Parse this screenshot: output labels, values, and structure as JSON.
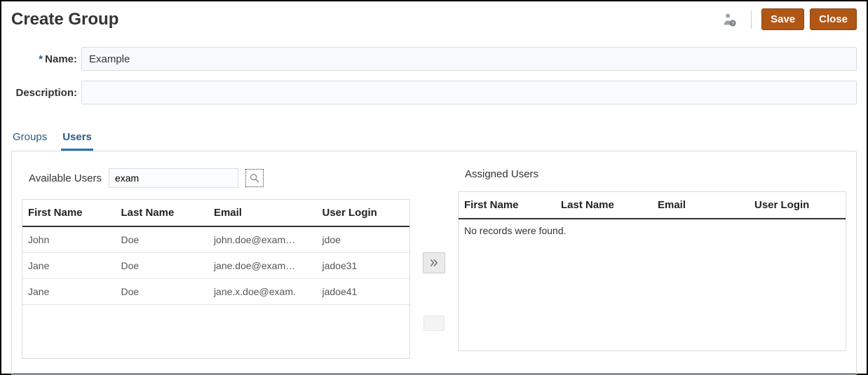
{
  "header": {
    "title": "Create Group",
    "save_label": "Save",
    "close_label": "Close"
  },
  "form": {
    "name_label": "Name:",
    "name_value": "Example",
    "desc_label": "Description:",
    "desc_value": "",
    "required_mark": "*"
  },
  "tabs": {
    "groups_label": "Groups",
    "users_label": "Users"
  },
  "available": {
    "title": "Available Users",
    "search_value": "exam",
    "columns": {
      "first": "First Name",
      "last": "Last Name",
      "email": "Email",
      "login": "User Login"
    },
    "rows": [
      {
        "first": "John",
        "last": "Doe",
        "email": "john.doe@exam…",
        "login": "jdoe"
      },
      {
        "first": "Jane",
        "last": "Doe",
        "email": "jane.doe@exam…",
        "login": "jadoe31"
      },
      {
        "first": "Jane",
        "last": "Doe",
        "email": "jane.x.doe@exam.",
        "login": "jadoe41"
      }
    ]
  },
  "assigned": {
    "title": "Assigned Users",
    "columns": {
      "first": "First Name",
      "last": "Last Name",
      "email": "Email",
      "login": "User Login"
    },
    "empty_message": "No records were found."
  }
}
